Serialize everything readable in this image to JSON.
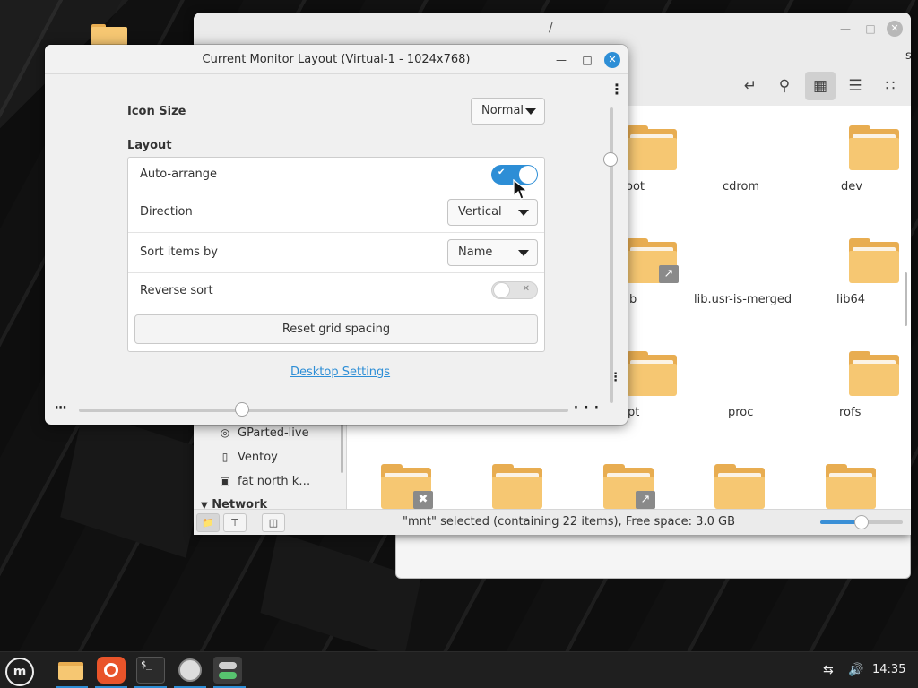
{
  "desktop": {
    "window_fm": {
      "title": "/",
      "status_text": "\"mnt\" selected (containing 22 items), Free space: 3.0 GB",
      "zoom_level": 0.5,
      "sidebar": {
        "items": [
          {
            "label": "GParted-live",
            "icon": "disc-icon"
          },
          {
            "label": "Ventoy",
            "icon": "usb-drive-icon"
          },
          {
            "label": "fat north k…",
            "icon": "drive-icon"
          }
        ],
        "network_header": "Network"
      },
      "files": [
        {
          "label": "oot"
        },
        {
          "label": "cdrom"
        },
        {
          "label": "dev"
        },
        {
          "label": "b"
        },
        {
          "label": "lib.usr-is-merged"
        },
        {
          "label": "lib64"
        },
        {
          "label": "pt"
        },
        {
          "label": "proc"
        },
        {
          "label": "rofs"
        }
      ],
      "edge_text": "sk"
    },
    "dialog": {
      "title": "Current Monitor Layout (Virtual-1 - 1024x768)",
      "icon_size_label": "Icon Size",
      "icon_size_value": "Normal",
      "layout_label": "Layout",
      "auto_arrange_label": "Auto-arrange",
      "auto_arrange_on": true,
      "direction_label": "Direction",
      "direction_value": "Vertical",
      "sort_label": "Sort items by",
      "sort_value": "Name",
      "reverse_label": "Reverse sort",
      "reverse_on": false,
      "reset_label": "Reset grid spacing",
      "link_label": "Desktop Settings"
    },
    "taskbar": {
      "clock": "14:35",
      "apps": [
        {
          "name": "files",
          "icon": "folder-icon"
        },
        {
          "name": "firefox",
          "icon": "firefox-icon"
        },
        {
          "name": "terminal",
          "icon": "terminal-icon"
        },
        {
          "name": "disks",
          "icon": "disk-utility-icon"
        },
        {
          "name": "settings",
          "icon": "settings-toggle-icon"
        }
      ]
    },
    "colors": {
      "accent": "#2d8ed6",
      "folder": "#f6c772"
    }
  }
}
